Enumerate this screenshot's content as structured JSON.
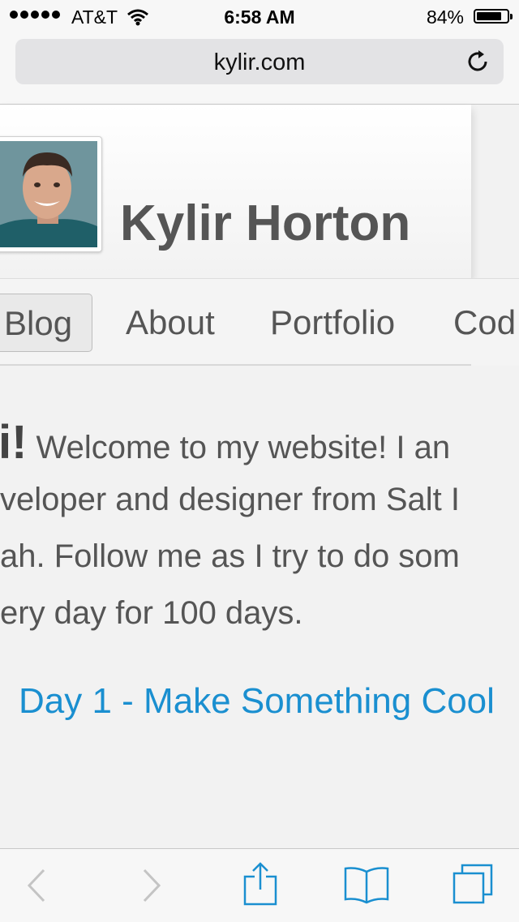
{
  "status_bar": {
    "carrier": "AT&T",
    "time": "6:58 AM",
    "battery_percent": "84%",
    "battery_level": 0.84,
    "icons": [
      "signal-dots-icon",
      "wifi-icon",
      "battery-icon"
    ]
  },
  "browser": {
    "url": "kylir.com",
    "reload_icon": "reload-icon"
  },
  "site": {
    "title": "Kylir Horton",
    "avatar": "profile-photo"
  },
  "nav": {
    "items": [
      {
        "label": "Blog",
        "active": true
      },
      {
        "label": "About",
        "active": false
      },
      {
        "label": "Portfolio",
        "active": false
      },
      {
        "label": "Cod",
        "active": false
      }
    ]
  },
  "intro": {
    "greeting": "i!",
    "line1_rest": " Welcome to my website! I an",
    "line2": "veloper and designer from Salt I",
    "line3": "ah. Follow me as I try to do som",
    "line4": "ery day for 100 days."
  },
  "post": {
    "link": "Day 1 - Make Something Cool"
  },
  "toolbar": {
    "icons": [
      "back-arrow-icon",
      "forward-arrow-icon",
      "share-icon",
      "bookmarks-icon",
      "tabs-icon"
    ],
    "accent": "#1a8fd0",
    "disabled": "#c4c4c4"
  }
}
